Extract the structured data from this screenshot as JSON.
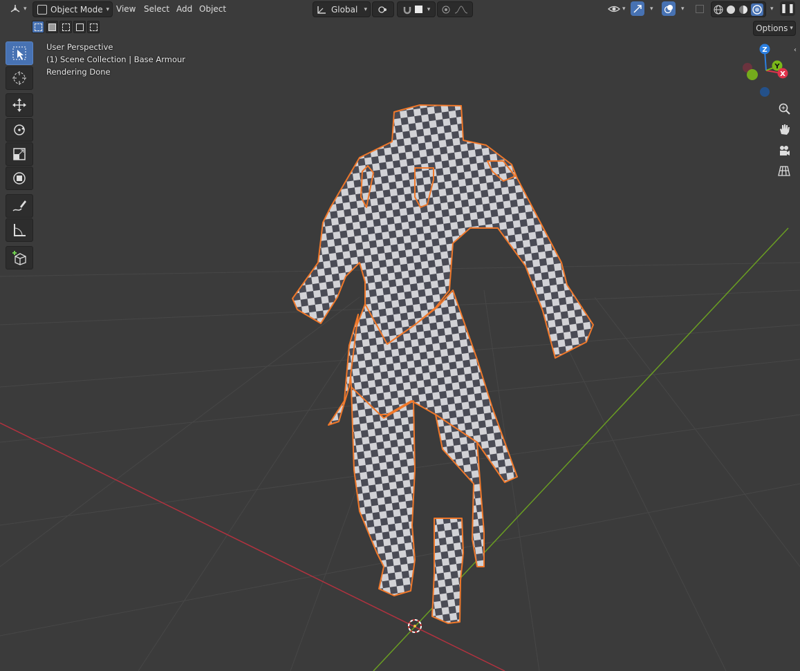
{
  "header": {
    "editor_type_icon": "3d-viewport-icon",
    "mode_label": "Object Mode",
    "menu": [
      "View",
      "Select",
      "Add",
      "Object"
    ],
    "transform_orientation": "Global",
    "options_label": "Options"
  },
  "overlay": {
    "line1": "User Perspective",
    "line2": "(1) Scene Collection | Base Armour",
    "line3": "Rendering Done"
  },
  "gizmo": {
    "x_label": "X",
    "y_label": "Y",
    "z_label": "Z",
    "colors": {
      "x": "#e0324b",
      "y": "#7bb819",
      "z": "#2b7fe0"
    }
  },
  "tools": [
    {
      "name": "select-box-tool",
      "icon": "cursor-select-icon"
    },
    {
      "name": "cursor-tool",
      "icon": "3d-cursor-icon"
    },
    {
      "name": "move-tool",
      "icon": "move-arrows-icon"
    },
    {
      "name": "rotate-tool",
      "icon": "rotate-icon"
    },
    {
      "name": "scale-tool",
      "icon": "scale-icon"
    },
    {
      "name": "transform-tool",
      "icon": "transform-icon"
    },
    {
      "name": "annotate-tool",
      "icon": "annotate-pen-icon"
    },
    {
      "name": "measure-tool",
      "icon": "measure-ruler-icon"
    },
    {
      "name": "add-cube-tool",
      "icon": "add-cube-icon"
    }
  ],
  "colors": {
    "selection_outline": "#f0782a",
    "accent": "#4772b3",
    "x_axis": "#b3323f",
    "y_axis": "#6a9e22"
  }
}
